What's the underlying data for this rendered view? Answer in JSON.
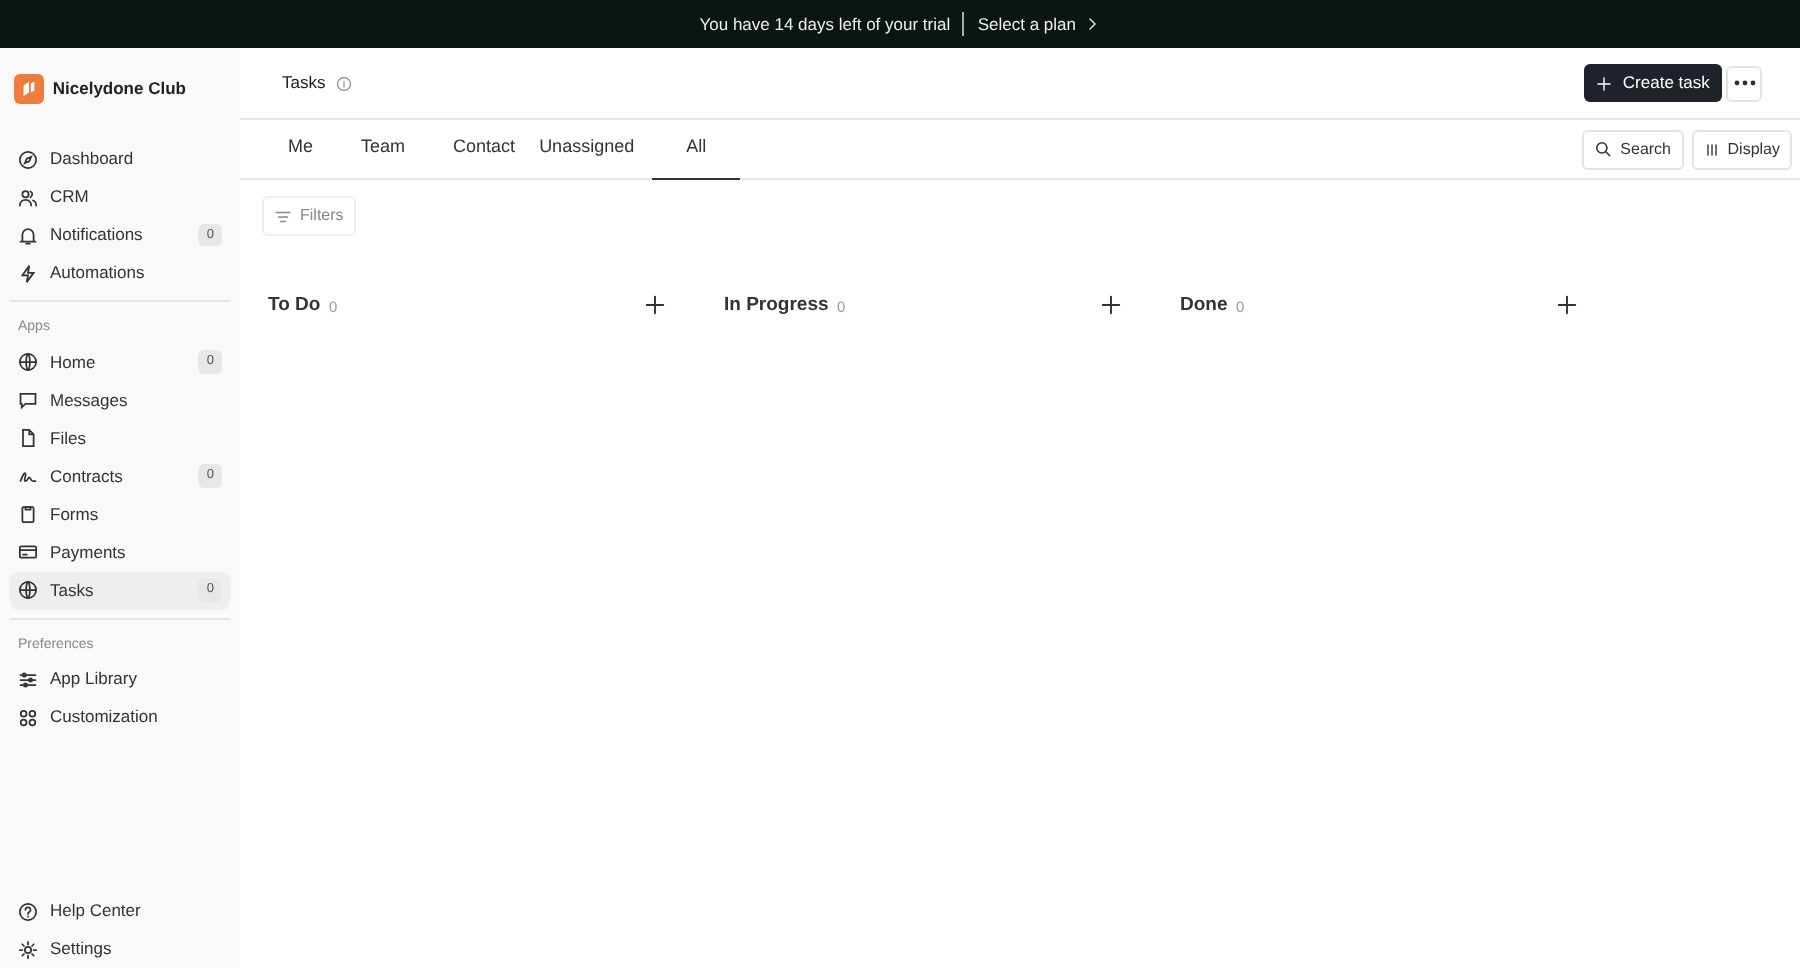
{
  "banner": {
    "message": "You have 14 days left of your trial",
    "link": "Select a plan"
  },
  "sidebar": {
    "workspace": "Nicelydone Club",
    "sections": [
      {
        "items": [
          {
            "label": "Dashboard",
            "selected": false
          },
          {
            "label": "CRM",
            "selected": false
          },
          {
            "label": "Notifications",
            "badge": "0",
            "selected": false
          },
          {
            "label": "Automations",
            "selected": false
          }
        ]
      },
      {
        "heading": "Apps",
        "items": [
          {
            "label": "Home",
            "badge": "0",
            "selected": false
          },
          {
            "label": "Messages",
            "selected": false
          },
          {
            "label": "Files",
            "selected": false
          },
          {
            "label": "Contracts",
            "badge": "0",
            "selected": false
          },
          {
            "label": "Forms",
            "selected": false
          },
          {
            "label": "Payments",
            "selected": false
          },
          {
            "label": "Tasks",
            "badge": "0",
            "selected": true
          }
        ]
      },
      {
        "heading": "Preferences",
        "items": [
          {
            "label": "App Library",
            "selected": false
          },
          {
            "label": "Customization",
            "selected": false
          }
        ]
      }
    ],
    "footer": [
      {
        "label": "Help Center"
      },
      {
        "label": "Settings"
      }
    ]
  },
  "header": {
    "title": "Tasks",
    "create_button": "Create task"
  },
  "tabs": [
    {
      "label": "Me",
      "selected": false
    },
    {
      "label": "Team",
      "selected": false
    },
    {
      "label": "Contact",
      "selected": false
    },
    {
      "label": "Unassigned",
      "selected": false
    },
    {
      "label": "All",
      "selected": true
    }
  ],
  "toolbar": {
    "search": "Search",
    "display": "Display",
    "filters": "Filters"
  },
  "columns": [
    {
      "title": "To Do",
      "count": "0"
    },
    {
      "title": "In Progress",
      "count": "0"
    },
    {
      "title": "Done",
      "count": "0"
    }
  ]
}
